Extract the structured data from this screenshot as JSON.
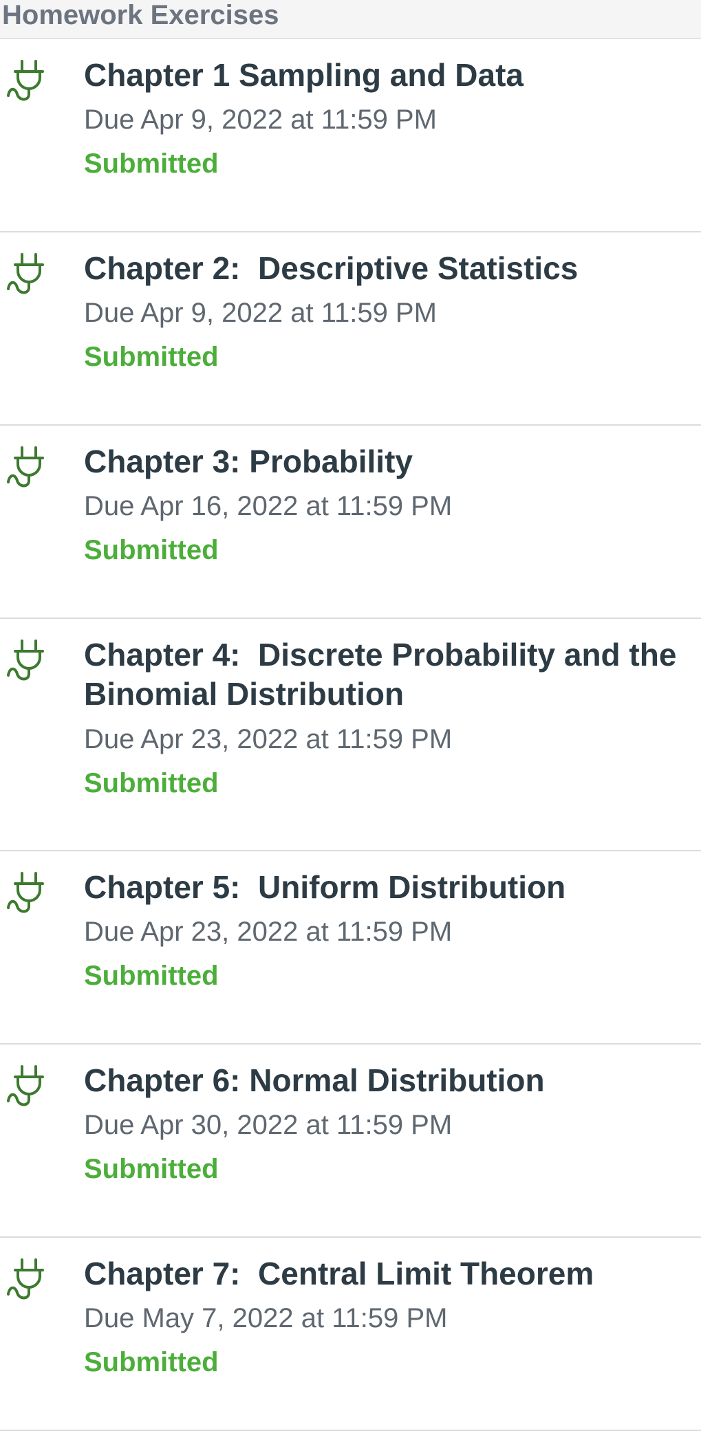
{
  "section": {
    "title": "Homework Exercises"
  },
  "colors": {
    "title": "#2d3b45",
    "due": "#5f6770",
    "submitted": "#4cae3a",
    "icon": "#3d7a2f"
  },
  "assignments": [
    {
      "icon": "plug-icon",
      "title": "Chapter 1 Sampling and Data",
      "due": "Due Apr 9, 2022 at 11:59 PM",
      "status": "Submitted"
    },
    {
      "icon": "plug-icon",
      "title": "Chapter 2:  Descriptive Statistics",
      "due": "Due Apr 9, 2022 at 11:59 PM",
      "status": "Submitted"
    },
    {
      "icon": "plug-icon",
      "title": "Chapter 3: Probability",
      "due": "Due Apr 16, 2022 at 11:59 PM",
      "status": "Submitted"
    },
    {
      "icon": "plug-icon",
      "title": "Chapter 4:  Discrete Probability and the Binomial Distribution",
      "due": "Due Apr 23, 2022 at 11:59 PM",
      "status": "Submitted"
    },
    {
      "icon": "plug-icon",
      "title": "Chapter 5:  Uniform Distribution",
      "due": "Due Apr 23, 2022 at 11:59 PM",
      "status": "Submitted"
    },
    {
      "icon": "plug-icon",
      "title": "Chapter 6: Normal Distribution",
      "due": "Due Apr 30, 2022 at 11:59 PM",
      "status": "Submitted"
    },
    {
      "icon": "plug-icon",
      "title": "Chapter 7:  Central Limit Theorem",
      "due": "Due May 7, 2022 at 11:59 PM",
      "status": "Submitted"
    }
  ]
}
